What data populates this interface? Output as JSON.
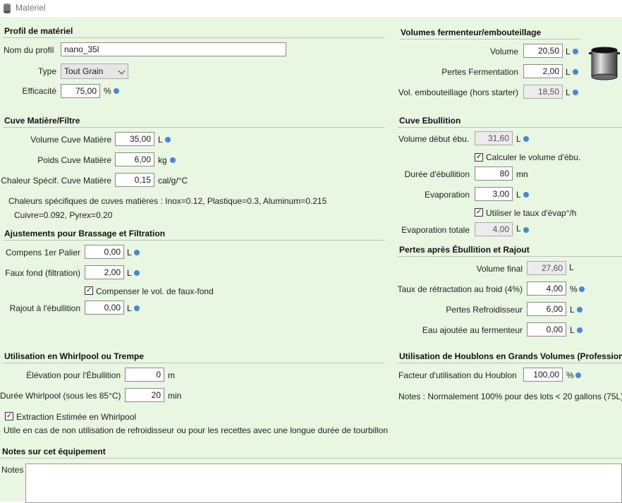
{
  "window": {
    "title": "Matériel"
  },
  "profile": {
    "header": "Profil de matériel",
    "name_label": "Nom du profil",
    "name_value": "nano_35l",
    "type_label": "Type",
    "type_value": "Tout Grain",
    "efficiency_label": "Efficacité",
    "efficiency_value": "75,00",
    "efficiency_unit": "%"
  },
  "mash_tun": {
    "header": "Cuve Matière/Filtre",
    "volume_label": "Volume Cuve Matière",
    "volume_value": "35,00",
    "volume_unit": "L",
    "weight_label": "Poids Cuve Matière",
    "weight_value": "6,00",
    "weight_unit": "kg",
    "heat_label": "Chaleur Spécif. Cuve Matière",
    "heat_value": "0,15",
    "heat_unit": "cal/g/°C",
    "note_line1": "Chaleurs spécifiques de cuves matières : Inox=0.12, Plastique=0.3, Aluminum=0.215",
    "note_line2": "Cuivre=0.092, Pyrex=0.20"
  },
  "adjustments": {
    "header": "Ajustements pour Brassage et Filtration",
    "first_step_label": "Compens 1er Palier",
    "first_step_value": "0,00",
    "first_step_unit": "L",
    "false_bottom_label": "Faux fond (filtration)",
    "false_bottom_value": "2,00",
    "false_bottom_unit": "L",
    "compensate_label": "Compenser le vol. de faux-fond",
    "boil_add_label": "Rajout à l'ébullition",
    "boil_add_value": "0,00",
    "boil_add_unit": "L"
  },
  "whirlpool": {
    "header": "Utilisation en Whirlpool ou Trempe",
    "elevation_label": "Élévation pour l'Ébullition",
    "elevation_value": "0",
    "elevation_unit": "m",
    "duration_label": "Durée Whirlpool (sous les 85°C)",
    "duration_value": "20",
    "duration_unit": "min",
    "estimated_label": "Extraction Estimée en Whirlpool",
    "note": "Utile en cas de non utilisation de refroidisseur ou pour les recettes avec une longue durée de tourbillon"
  },
  "fermenter": {
    "header": "Volumes fermenteur/embouteillage",
    "volume_label": "Volume",
    "volume_value": "20,50",
    "volume_unit": "L",
    "losses_label": "Pertes Fermentation",
    "losses_value": "2,00",
    "losses_unit": "L",
    "bottling_label": "Vol. embouteillage (hors starter)",
    "bottling_value": "18,50",
    "bottling_unit": "L"
  },
  "boil": {
    "header": "Cuve Ebullition",
    "start_label": "Volume début ébu.",
    "start_value": "31,60",
    "start_unit": "L",
    "calc_label": "Calculer le volume d'ébu.",
    "duration_label": "Durée d'ébullition",
    "duration_value": "80",
    "duration_unit": "mn",
    "evap_label": "Evaporation",
    "evap_value": "3,00",
    "evap_unit": "L",
    "rate_label": "Utiliser le taux d'évap°/h",
    "total_label": "Evaporation totale",
    "total_value": "4,00",
    "total_unit": "L"
  },
  "losses": {
    "header": "Pertes après Ébullition et Rajout",
    "final_label": "Volume final",
    "final_value": "27,60",
    "final_unit": "L",
    "shrink_label": "Taux de rétractation au froid (4%)",
    "shrink_value": "4,00",
    "shrink_unit": "%",
    "chiller_label": "Pertes Refroidisseur",
    "chiller_value": "6,00",
    "chiller_unit": "L",
    "water_label": "Eau ajoutée au fermenteur",
    "water_value": "0,00",
    "water_unit": "L"
  },
  "hops": {
    "header": "Utilisation de Houblons en Grands Volumes (Professionne",
    "factor_label": "Facteur d'utilisation du Houblon",
    "factor_value": "100,00",
    "factor_unit": "%",
    "note": "Notes : Normalement  100% pour des lots < 20 gallons (75L)"
  },
  "notes": {
    "header": "Notes sur cet équipement",
    "label": "Notes",
    "value": ""
  },
  "colors": {
    "background": "#e9f7e2",
    "info_dot": "#4a86d8"
  }
}
